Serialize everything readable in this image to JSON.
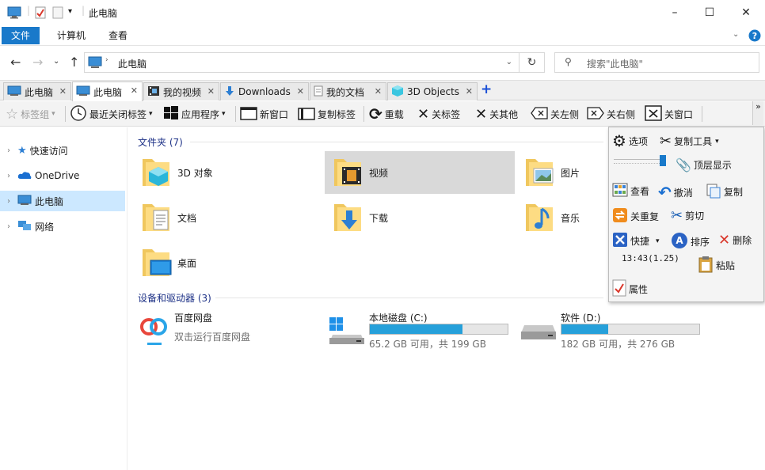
{
  "titlebar": {
    "title": "此电脑",
    "minimize": "–",
    "maximize": "☐",
    "close": "✕"
  },
  "ribbon": {
    "tabs": [
      "文件",
      "计算机",
      "查看"
    ]
  },
  "address": {
    "path": "此电脑",
    "search_placeholder": "搜索\"此电脑\""
  },
  "tabs": [
    {
      "label": "此电脑",
      "icon": "pc-icon"
    },
    {
      "label": "此电脑",
      "icon": "pc-icon",
      "active": true
    },
    {
      "label": "我的视频",
      "icon": "video-icon"
    },
    {
      "label": "Downloads",
      "icon": "download-icon"
    },
    {
      "label": "我的文档",
      "icon": "document-icon"
    },
    {
      "label": "3D Objects",
      "icon": "cube-icon"
    }
  ],
  "toolbar": {
    "bookmarks": "标签组",
    "recent_closed": "最近关闭标签",
    "programs": "应用程序",
    "new_window": "新窗口",
    "copy_tab": "复制标签",
    "reload": "重载",
    "close_tab": "关标签",
    "close_others": "关其他",
    "close_left": "关左侧",
    "close_right": "关右侧",
    "close_window": "关窗口"
  },
  "sidebar": {
    "items": [
      {
        "label": "快速访问"
      },
      {
        "label": "OneDrive"
      },
      {
        "label": "此电脑",
        "selected": true
      },
      {
        "label": "网络"
      }
    ]
  },
  "folders_section": {
    "title": "文件夹 (7)",
    "items": [
      "3D 对象",
      "视频",
      "图片",
      "文档",
      "下载",
      "音乐",
      "桌面"
    ]
  },
  "devices_section": {
    "title": "设备和驱动器 (3)",
    "baidu": {
      "name": "百度网盘",
      "sub": "双击运行百度网盘"
    },
    "drives": [
      {
        "name": "本地磁盘 (C:)",
        "usage": "65.2 GB 可用，共 199 GB",
        "used_fraction": 0.67
      },
      {
        "name": "软件 (D:)",
        "usage": "182 GB 可用，共 276 GB",
        "used_fraction": 0.34
      }
    ]
  },
  "popup": {
    "options": "选项",
    "copy_tool": "复制工具",
    "topmost": "顶层显示",
    "view": "查看",
    "undo": "撤消",
    "copy": "复制",
    "close_reopen": "关重复",
    "cut": "剪切",
    "shortcut": "快捷",
    "sort": "排序",
    "delete": "删除",
    "clock": "13:43(1.25)",
    "paste": "粘贴",
    "properties": "属性"
  },
  "colors": {
    "accent": "#1979ca",
    "selection": "#cce8ff",
    "drive_fill": "#26a0da",
    "section_title": "#1e3287"
  }
}
